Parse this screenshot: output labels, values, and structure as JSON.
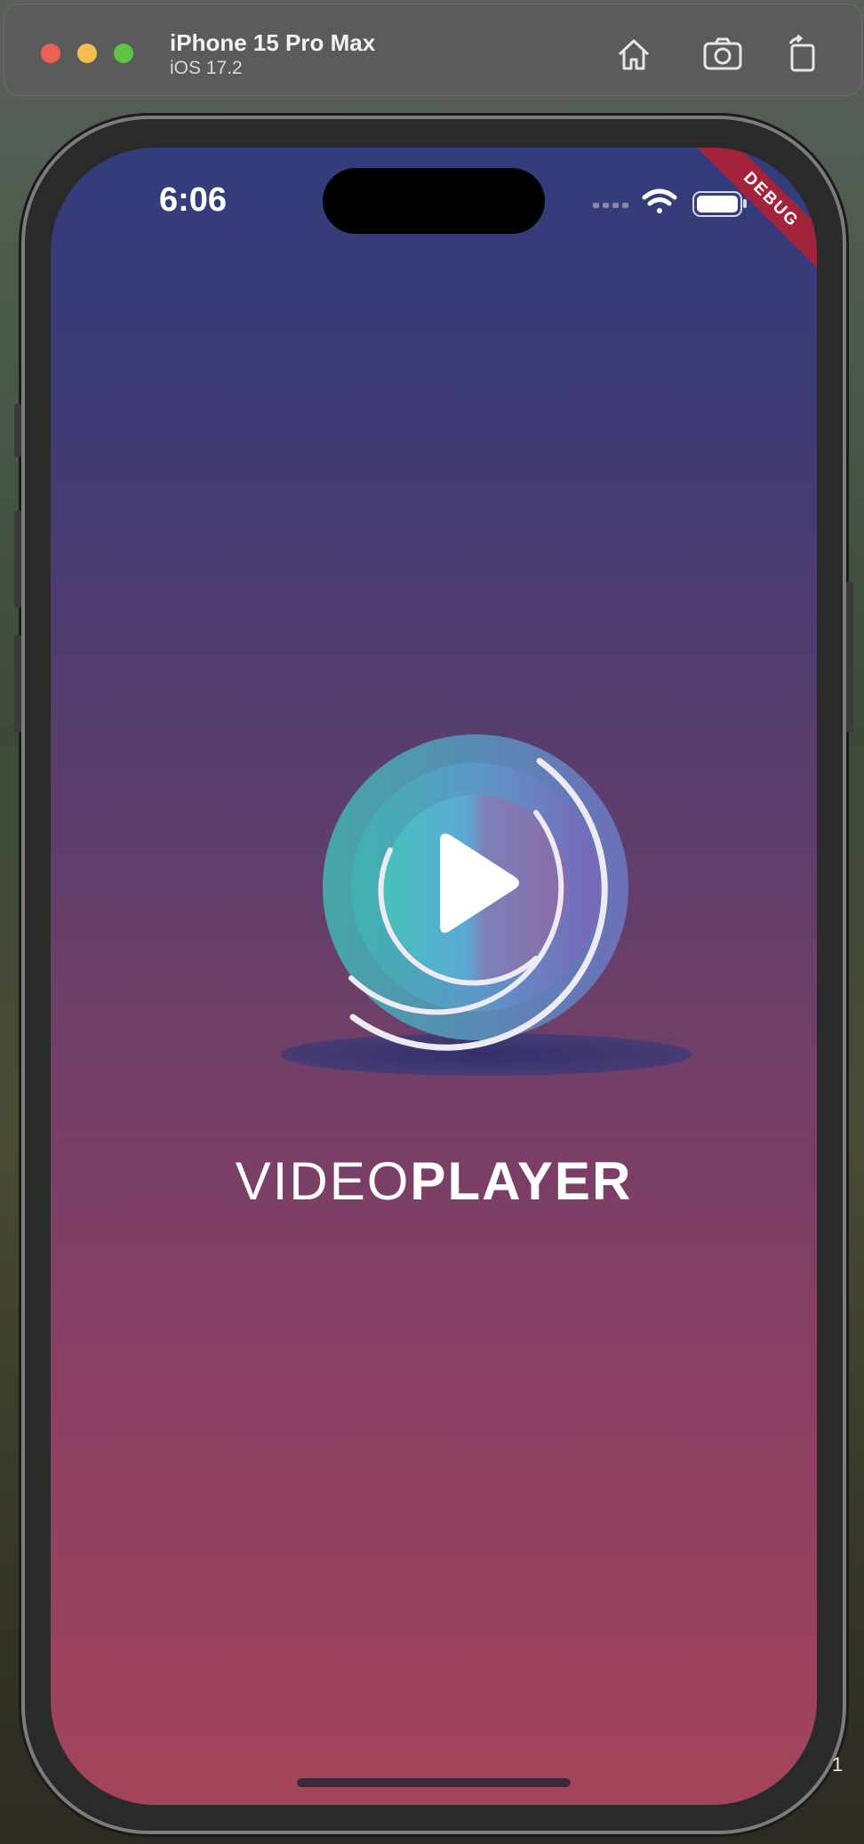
{
  "simulator": {
    "device_name": "iPhone 15 Pro Max",
    "os_version": "iOS 17.2",
    "buttons": [
      "home-icon",
      "screenshot-icon",
      "rotate-icon"
    ]
  },
  "status_bar": {
    "time": "6:06"
  },
  "debug_banner": "DEBUG",
  "app": {
    "wordmark_light": "VIDEO",
    "wordmark_bold": "PLAYER"
  },
  "corner_number": "1",
  "colors": {
    "gradient_top": "#323d7c",
    "gradient_bottom": "#a4445b",
    "debug_ribbon": "#a3223c",
    "logo_teal": "#3fb3ae",
    "logo_purple": "#7b68b8"
  }
}
